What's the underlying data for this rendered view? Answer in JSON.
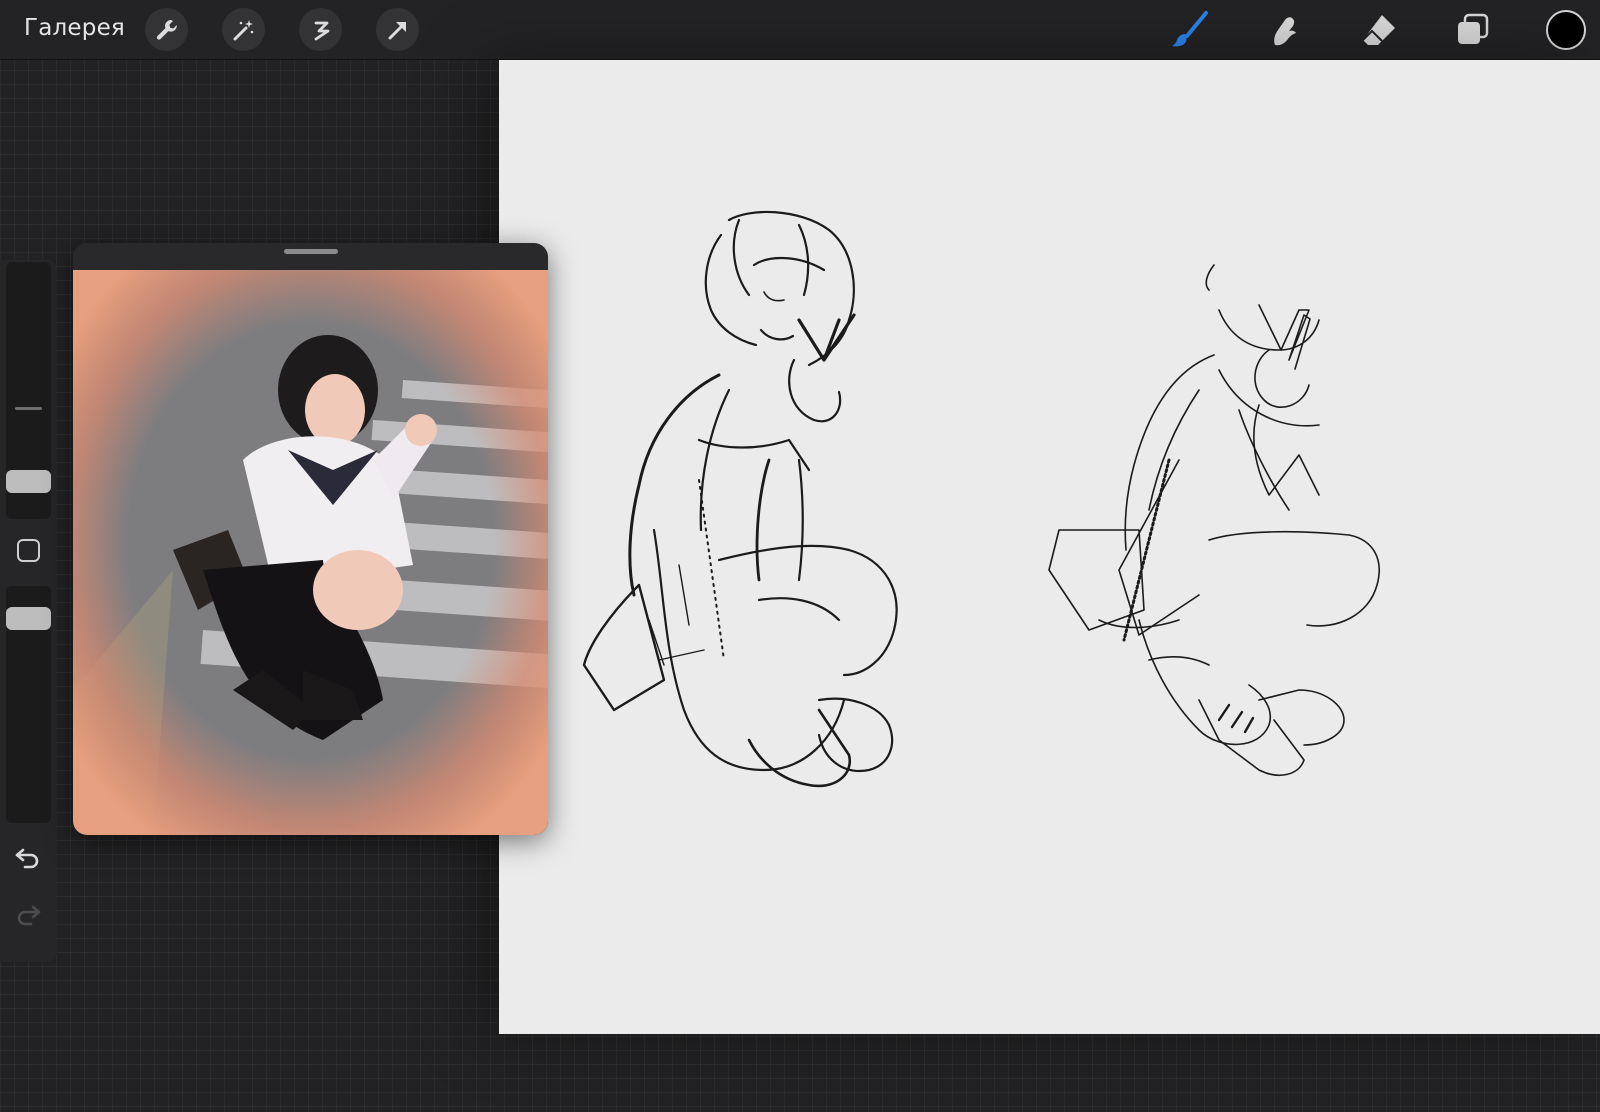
{
  "toolbar": {
    "gallery_label": "Галерея",
    "left_tools": [
      "wrench-icon",
      "magic-wand-icon",
      "selection-icon",
      "transform-arrow-icon"
    ],
    "right_tools": [
      "brush-icon",
      "smudge-icon",
      "eraser-icon",
      "layers-icon"
    ],
    "active_tool": "brush",
    "accent_color": "#1f7ae0",
    "current_color": "#000000"
  },
  "sidebar": {
    "brush_size": 0.68,
    "opacity": 1.0,
    "controls": [
      "size-slider",
      "modify-square",
      "opacity-slider",
      "undo-arrow",
      "redo-arrow"
    ]
  },
  "reference": {
    "description_icon": "photo-reference"
  }
}
